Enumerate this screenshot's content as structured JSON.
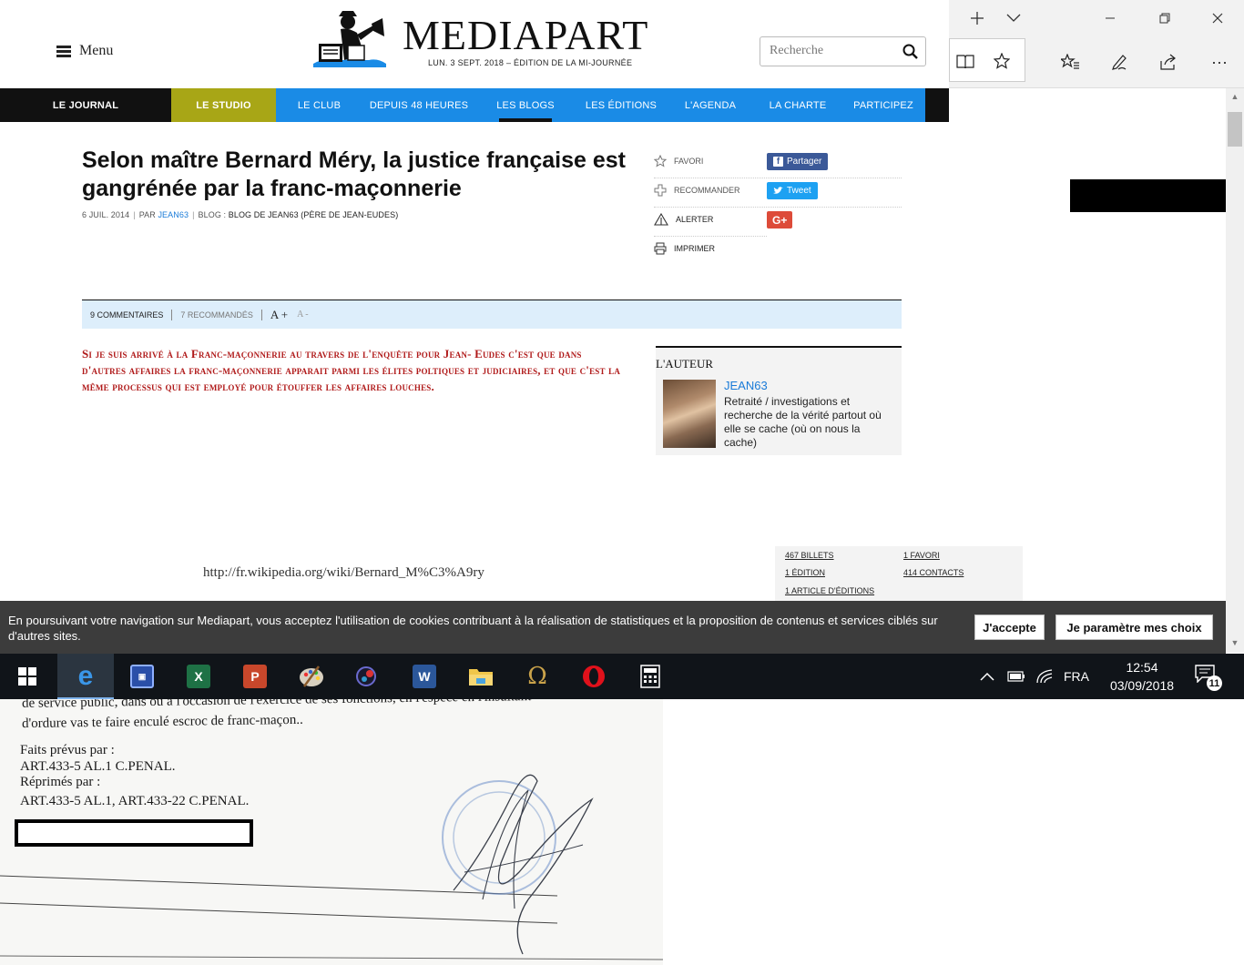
{
  "header": {
    "menu_label": "Menu",
    "logo_text": "MEDIAPART",
    "logo_subtitle": "LUN. 3 SEPT. 2018  –  ÉDITION DE LA MI-JOURNÉE",
    "search_placeholder": "Recherche"
  },
  "nav": {
    "items": [
      {
        "label": "LE JOURNAL"
      },
      {
        "label": "LE STUDIO"
      },
      {
        "label": "LE CLUB"
      },
      {
        "label": "DEPUIS 48 HEURES"
      },
      {
        "label": "LES BLOGS"
      },
      {
        "label": "LES ÉDITIONS"
      },
      {
        "label": "L'AGENDA"
      },
      {
        "label": "LA CHARTE"
      },
      {
        "label": "PARTICIPEZ"
      }
    ],
    "active": "LES BLOGS"
  },
  "article": {
    "title": "Selon maître Bernard Méry, la justice française est gangrénée par la franc-maçonnerie",
    "date": "6 JUIL. 2014",
    "by_label": "PAR",
    "author_link": "JEAN63",
    "blog_label": "BLOG :",
    "blog_name": "BLOG DE JEAN63 (PÈRE DE JEAN-EUDES)",
    "chapo": "Si je suis arrivé à la Franc-maçonnerie au travers de l'enquête pour Jean- Eudes c'est que dans d'autres affaires la franc-maçonnerie apparait parmi les élites poltiques et judiciaires, et que c'est la même processus qui est employé pour étouffer les affaires louches.",
    "wiki_link": "http://fr.wikipedia.org/wiki/Bernard_M%C3%A9ry"
  },
  "share": {
    "favori": "FAVORI",
    "recommander": "RECOMMANDER",
    "alerter": "ALERTER",
    "imprimer": "IMPRIMER",
    "facebook": "Partager",
    "twitter": "Tweet",
    "gplus": "G+"
  },
  "toolbar": {
    "comments": "9 COMMENTAIRES",
    "recommended": "7 RECOMMANDÉS",
    "font_up": "A +",
    "font_down": "A -"
  },
  "author": {
    "heading": "L'AUTEUR",
    "name": "JEAN63",
    "bio": "Retraité / investigations et recherche de la vérité partout où elle se cache (où on nous la cache)"
  },
  "stats": {
    "billets": "467 BILLETS",
    "favori": "1 FAVORI",
    "edition": "1 ÉDITION",
    "contacts": "414 CONTACTS",
    "article_editions": "1 ARTICLE D'ÉDITIONS"
  },
  "cookie": {
    "text": "En poursuivant votre navigation sur Mediapart, vous acceptez l'utilisation de cookies contribuant à la réalisation de statistiques et la proposition de contenus et services ciblés sur d'autres sites.",
    "accept": "J'accepte",
    "settings": "Je paramètre mes choix"
  },
  "taskbar": {
    "language": "FRA",
    "time": "12:54",
    "date": "03/09/2018",
    "notifications": "11",
    "apps": [
      "start-icon",
      "edge-icon",
      "save-icon",
      "excel-icon",
      "powerpoint-icon",
      "paint-icon",
      "media-icon",
      "word-icon",
      "file-explorer-icon",
      "omega-icon",
      "opera-icon",
      "calculator-icon"
    ]
  },
  "scan": {
    "line1": "de service public, dans ou à l'occasion de l'exercice de ses fonctions, en l'espèce en l'insultant",
    "line2": "d'ordure vas te faire enculé escroc de franc-maçon..",
    "line3": "Faits prévus par :",
    "line4": "ART.433-5 AL.1 C.PENAL.",
    "line5": "Réprimés par :",
    "line6": "ART.433-5 AL.1, ART.433-22 C.PENAL."
  },
  "colors": {
    "nav_blue": "#1a8be6",
    "studio_olive": "#a8a616",
    "chapo_red": "#b01a1a",
    "link_blue": "#1a7bd8",
    "cookie_bg": "#3c3c3c",
    "taskbar_bg": "#101419"
  }
}
